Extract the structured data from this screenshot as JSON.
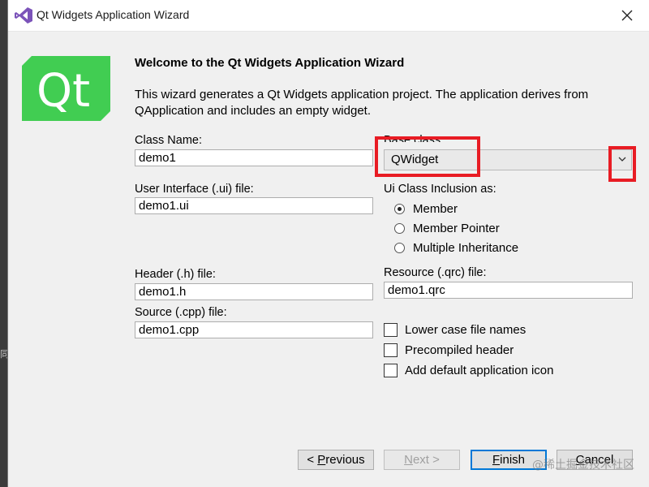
{
  "window": {
    "title": "Qt Widgets Application Wizard",
    "close_icon": "close-icon",
    "app_icon": "visual-studio-icon"
  },
  "background": {
    "side_text": "同"
  },
  "logo": {
    "text": "Qt",
    "color": "#41cd52"
  },
  "page": {
    "heading": "Welcome to the Qt Widgets Application Wizard",
    "description": "This wizard generates a Qt Widgets application project. The application derives from QApplication and includes an empty widget."
  },
  "form": {
    "class_name_label": "Class Name:",
    "class_name_value": "demo1",
    "base_class_label": "Base class:",
    "base_class_value": "QWidget",
    "ui_file_label": "User Interface (.ui) file:",
    "ui_file_value": "demo1.ui",
    "inclusion_label": "Ui Class Inclusion as:",
    "inclusion_options": [
      {
        "label": "Member",
        "selected": true
      },
      {
        "label": "Member Pointer",
        "selected": false
      },
      {
        "label": "Multiple Inheritance",
        "selected": false
      }
    ],
    "header_label": "Header (.h) file:",
    "header_value": "demo1.h",
    "resource_label": "Resource (.qrc) file:",
    "resource_value": "demo1.qrc",
    "source_label": "Source (.cpp) file:",
    "source_value": "demo1.cpp",
    "checkboxes": [
      {
        "label": "Lower case file names",
        "checked": false
      },
      {
        "label": "Precompiled header",
        "checked": false
      },
      {
        "label": "Add default application icon",
        "checked": false
      }
    ]
  },
  "buttons": {
    "previous_prefix": "< ",
    "previous_key": "P",
    "previous_rest": "revious",
    "next_key": "N",
    "next_rest": "ext >",
    "finish_key": "F",
    "finish_rest": "inish",
    "cancel_key": "C",
    "cancel_rest": "ancel"
  },
  "highlight_color": "#e81c24",
  "watermark": "@稀土掘金技术社区"
}
